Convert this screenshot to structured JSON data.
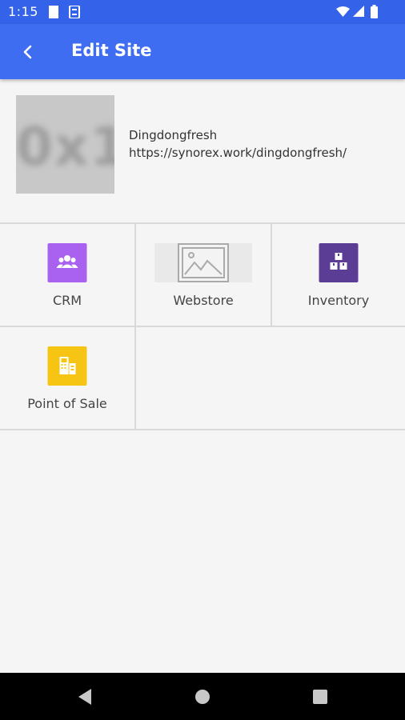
{
  "status_bar": {
    "time": "1:15"
  },
  "app_bar": {
    "title": "Edit Site"
  },
  "site": {
    "thumbnail_text": "0x1",
    "name": "Dingdongfresh",
    "url": "https://synorex.work/dingdongfresh/"
  },
  "apps": [
    {
      "label": "CRM",
      "icon": "crm-people-icon",
      "color": "#a962f0"
    },
    {
      "label": "Webstore",
      "icon": "image-placeholder-icon",
      "color": "#e9e9e9"
    },
    {
      "label": "Inventory",
      "icon": "boxes-icon",
      "color": "#5b3d96"
    },
    {
      "label": "Point of Sale",
      "icon": "pos-terminal-icon",
      "color": "#f6c513"
    }
  ]
}
